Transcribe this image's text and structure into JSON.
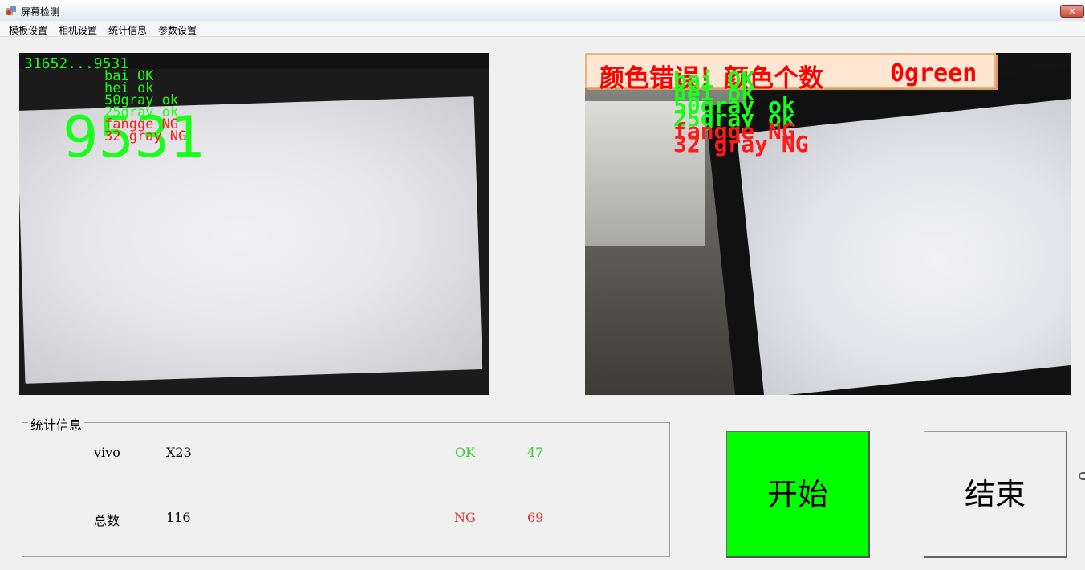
{
  "window": {
    "title": "屏幕检测",
    "close_label": "✕"
  },
  "menu": [
    "模板设置",
    "相机设置",
    "统计信息",
    "参数设置"
  ],
  "camera_left": {
    "header": "31652...9531",
    "big_code": "9531",
    "results": [
      {
        "text": "bai OK",
        "status": "ok"
      },
      {
        "text": "hei ok",
        "status": "ok"
      },
      {
        "text": "50gray ok",
        "status": "ok"
      },
      {
        "text": "25gray ok",
        "status": "ok"
      },
      {
        "text": "fangge NG",
        "status": "ng"
      },
      {
        "text": "32 gray NG",
        "status": "ng"
      }
    ]
  },
  "camera_right": {
    "banner_text": "颜色错误！颜色个数",
    "banner_value": "0green",
    "results": [
      {
        "text": "bai OK",
        "status": "ok"
      },
      {
        "text": "hei ok",
        "status": "ok"
      },
      {
        "text": "50gray ok",
        "status": "ok"
      },
      {
        "text": "25gray ok",
        "status": "ok"
      },
      {
        "text": "fangge NG",
        "status": "ng"
      },
      {
        "text": "32 gray NG",
        "status": "ng"
      }
    ]
  },
  "stats": {
    "group_title": "统计信息",
    "brand": "vivo",
    "model": "X23",
    "ok_label": "OK",
    "ok_count": "47",
    "total_label": "总数",
    "total_count": "116",
    "ng_label": "NG",
    "ng_count": "69"
  },
  "buttons": {
    "start": "开始",
    "end": "结束"
  },
  "colors": {
    "ok": "#1aff1a",
    "ng": "#ff1a1a",
    "start_button": "#00ff00",
    "ok_text": "#33cc33",
    "ng_text": "#e03030"
  }
}
